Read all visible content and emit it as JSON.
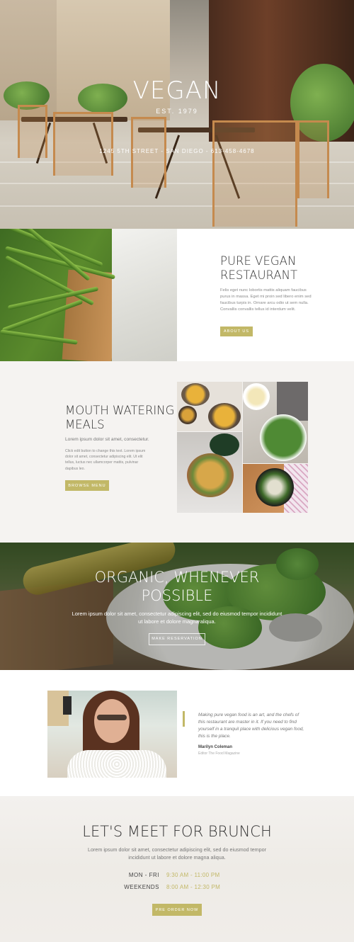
{
  "hero": {
    "title": "VEGAN",
    "est": "EST. 1979",
    "address": "1245 5TH STREET - SAN DIEGO - 613-458-4678"
  },
  "about": {
    "title_line1": "PURE VEGAN",
    "title_line2": "RESTAURANT",
    "body": "Felis eget nunc lobortis mattis aliquam faucibus purus in massa. Eget mi proin sed libero enim sed faucibus turpis in. Ornare arcu odio ut sem nulla. Convallis convallis tellus id interdum velit.",
    "button": "ABOUT US"
  },
  "meals": {
    "title_line1": "MOUTH WATERING",
    "title_line2": "MEALS",
    "lead": "Lorem ipsum dolor sit amet, consectetur.",
    "body": "Click edit button to change this text. Lorem ipsum dolor sit amet, consectetur adipiscing elit. Ut elit tellus, luctus nec ullamcorper mattis, pulvinar dapibus leo.",
    "button": "BROWSE MENU"
  },
  "organic": {
    "title_line1": "ORGANIC, WHENEVER",
    "title_line2": "POSSIBLE",
    "body": "Lorem ipsum dolor sit amet, consectetur adipiscing elit, sed do eiusmod tempor incididunt ut labore et dolore magna aliqua.",
    "button": "MAKE RESERVATION"
  },
  "quote": {
    "text": "Making pure vegan food is an art, and the chefs of this restaurant are master in it. If you need to find yourself in a tranquil place with delicious vegan food, this is the place.",
    "name": "Marilyn Coleman",
    "role": "Editor The Food Magazine"
  },
  "brunch": {
    "title": "LET'S MEET FOR BRUNCH",
    "body": "Lorem ipsum dolor sit amet, consectetur adipiscing elit, sed do eiusmod tempor incididunt ut labore et dolore magna aliqua.",
    "hours": [
      {
        "day": "MON - FRI",
        "time": "9:30 AM - 11:00 PM"
      },
      {
        "day": "WEEKENDS",
        "time": "8:00 AM - 12:30 PM"
      }
    ],
    "button": "PRE ORDER NOW"
  },
  "colors": {
    "accent": "#c2b867",
    "section_bg": "#f5f3f1",
    "text_dark": "#333333"
  }
}
